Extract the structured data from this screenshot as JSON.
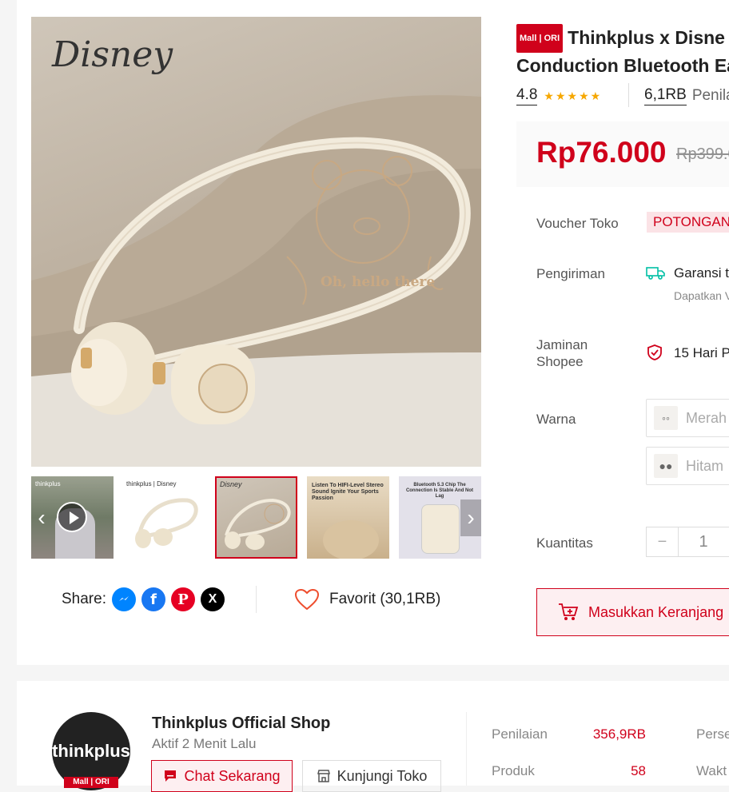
{
  "product": {
    "mall_badge": "Mall | ORI",
    "title_line1": "Thinkplus x Disne",
    "title_line2": "Conduction Bluetooth Ea",
    "rating": "4.8",
    "review_count": "6,1RB",
    "review_label": "Penila",
    "price": "Rp76.000",
    "old_price": "Rp399.0",
    "image_brand_text": "Disney",
    "image_caption_text": "Oh, hello there"
  },
  "thumbs": [
    {
      "name": "video-thumb",
      "text": "thinkplus"
    },
    {
      "name": "white-earphones-thumb",
      "text": "thinkplus | Disney"
    },
    {
      "name": "pooh-earphones-thumb",
      "text": "Disney"
    },
    {
      "name": "hifi-thumb",
      "text": "Listen To HIFI-Level Stereo Sound Ignite Your Sports Passion"
    },
    {
      "name": "bluetooth-thumb",
      "text": "Bluetooth 5.3 Chip The Connection Is Stable And Not Lag"
    }
  ],
  "share": {
    "label": "Share:",
    "favorite": "Favorit (30,1RB)"
  },
  "details": {
    "voucher_label": "Voucher Toko",
    "voucher_value": "POTONGAN",
    "shipping_label": "Pengiriman",
    "shipping_value": "Garansi t",
    "shipping_sub": "Dapatkan V",
    "guarantee_label_1": "Jaminan",
    "guarantee_label_2": "Shopee",
    "guarantee_value": "15 Hari P",
    "color_label": "Warna",
    "color_options": [
      "Merah",
      "Hitam"
    ],
    "qty_label": "Kuantitas",
    "qty_value": "1",
    "qty_minus": "−",
    "cart_button": "Masukkan Keranjang"
  },
  "shop": {
    "logo_text": "thinkplus",
    "logo_badge": "Mall | ORI",
    "name": "Thinkplus Official Shop",
    "active": "Aktif 2 Menit Lalu",
    "chat_button": "Chat Sekarang",
    "visit_button": "Kunjungi Toko",
    "stats": [
      {
        "label": "Penilaian",
        "value": "356,9RB"
      },
      {
        "label": "Produk",
        "value": "58"
      }
    ],
    "stats_right": [
      "Perse",
      "Wakt"
    ]
  },
  "colors": {
    "accent": "#d0011b",
    "star": "#f6a700"
  }
}
